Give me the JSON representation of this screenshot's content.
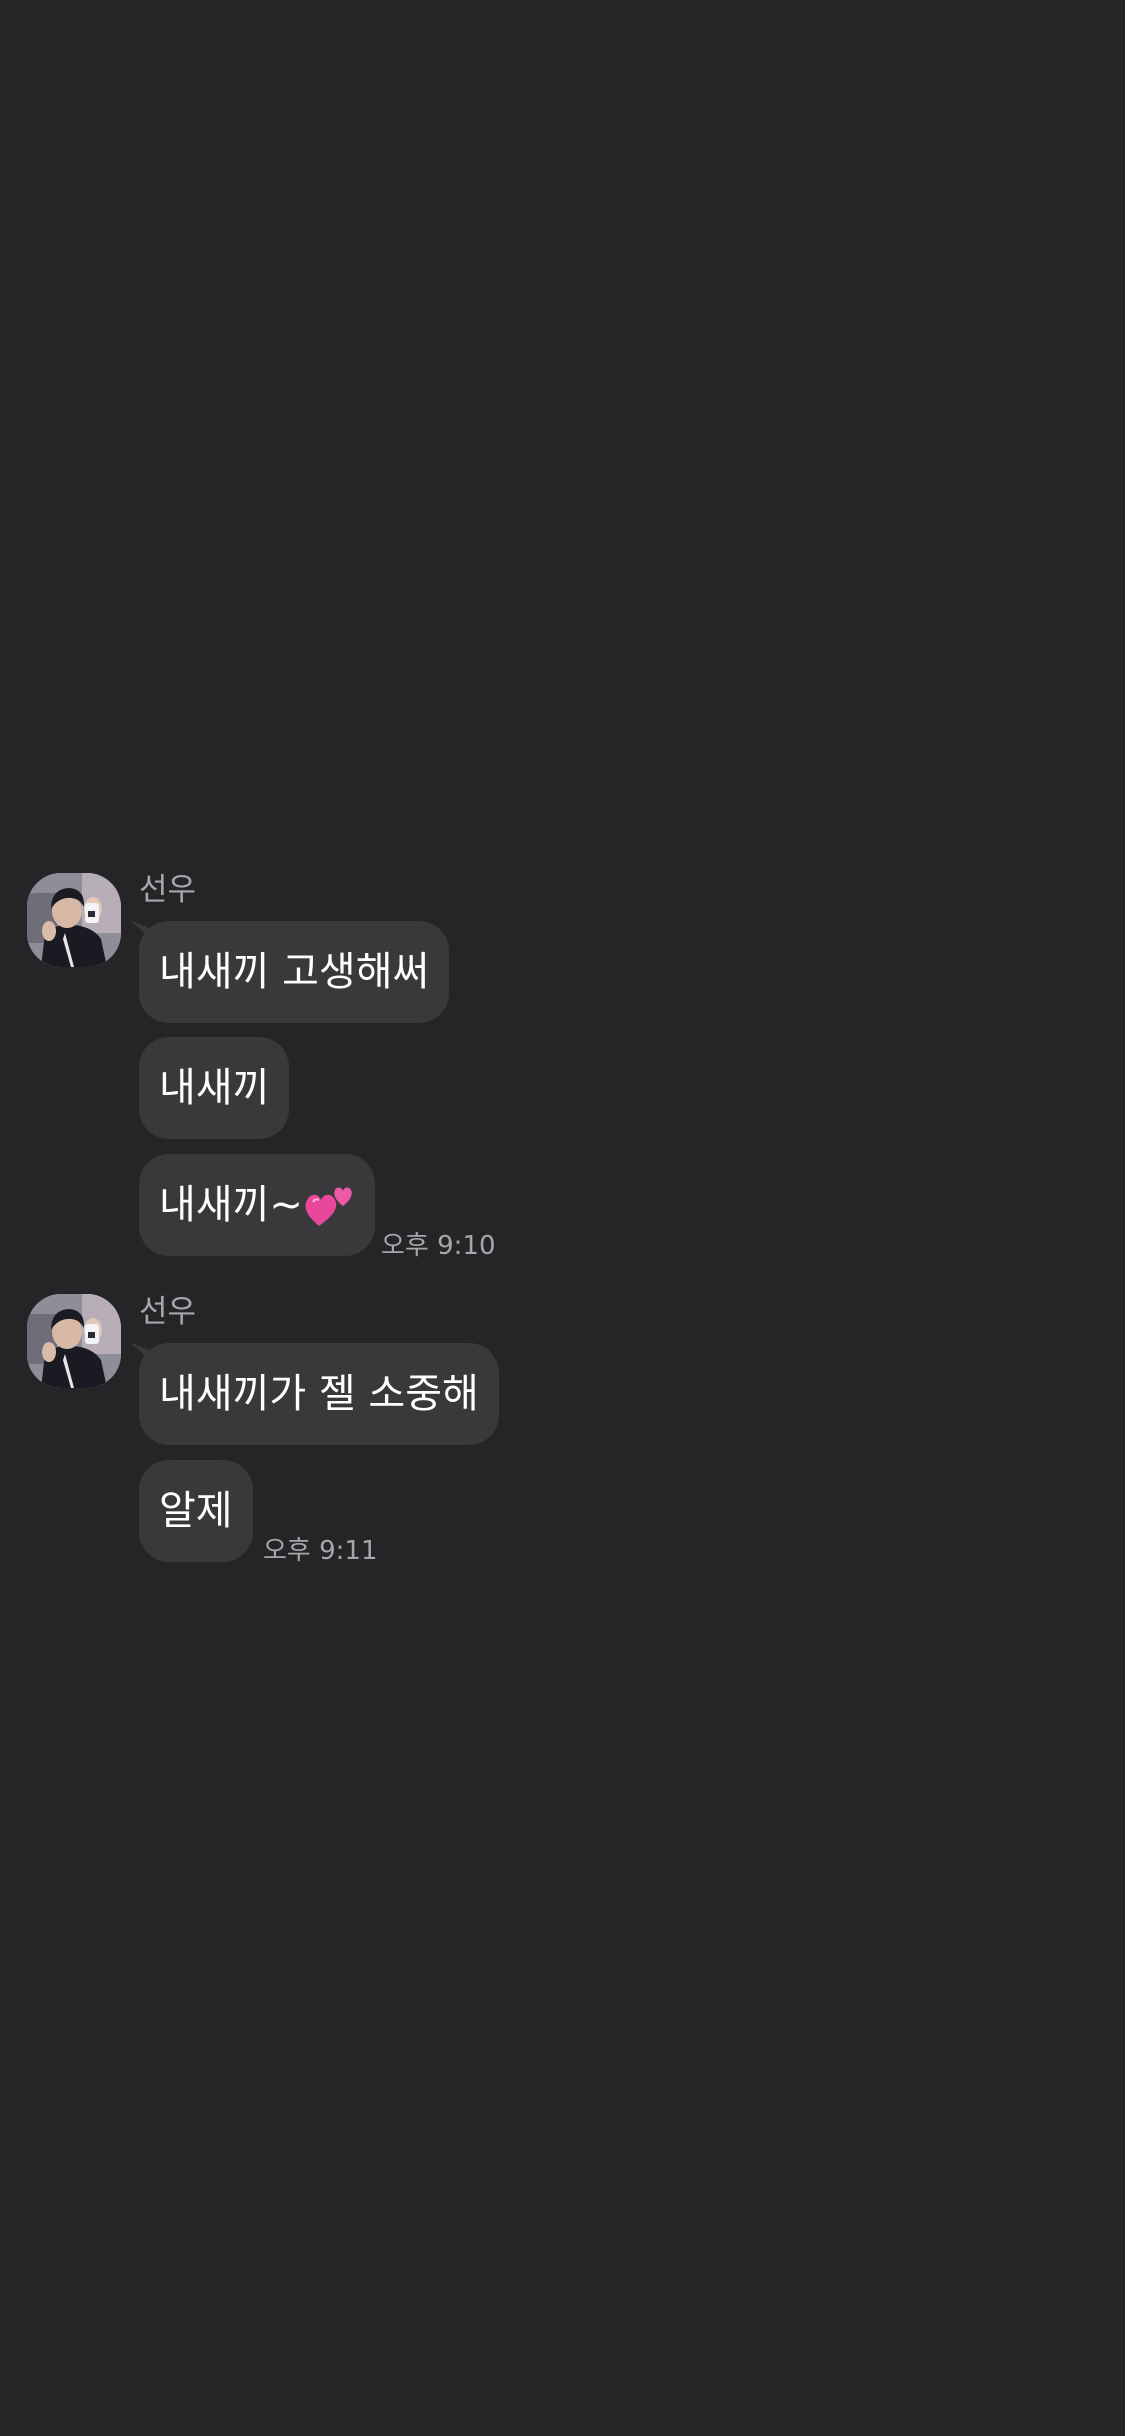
{
  "chat": {
    "groups": [
      {
        "sender": "선우",
        "avatar_icon": "profile-photo",
        "messages": [
          {
            "text": "내새끼 고생해써"
          },
          {
            "text": "내새끼"
          },
          {
            "text": "내새끼~",
            "emoji": "two-hearts-icon"
          }
        ],
        "time": "오후 9:10"
      },
      {
        "sender": "선우",
        "avatar_icon": "profile-photo",
        "messages": [
          {
            "text": "내새끼가 젤 소중해"
          },
          {
            "text": "알제"
          }
        ],
        "time": "오후 9:11"
      }
    ]
  },
  "colors": {
    "background": "#252527",
    "bubble": "#39393c",
    "text": "#ffffff",
    "meta_text": "#a6a6ab",
    "heart": "#e8479b"
  }
}
